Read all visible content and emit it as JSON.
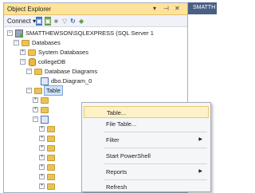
{
  "panel": {
    "title": "Object Explorer",
    "title_buttons": [
      "▾",
      "⊣",
      "✕"
    ]
  },
  "toolbar": {
    "connect_label": "Connect ▾",
    "icons": [
      "connect-object-icon",
      "disconnect-icon",
      "stop-icon",
      "filter-icon",
      "refresh-icon",
      "activity-monitor-icon"
    ]
  },
  "tree": {
    "server": "SMATTHEWSON\\SQLEXPRESS (SQL Server 1",
    "databases": "Databases",
    "system_databases": "System Databases",
    "college_db": "collegeDB",
    "database_diagrams": "Database Diagrams",
    "diagram_0": "dbo.Diagram_0",
    "tables": "Table"
  },
  "context_menu": {
    "items": [
      {
        "label": "Table...",
        "submenu": false,
        "highlighted": true
      },
      {
        "label": "File Table...",
        "submenu": false
      },
      {
        "label": "Filter",
        "submenu": true
      },
      {
        "label": "Start PowerShell",
        "submenu": false
      },
      {
        "label": "Reports",
        "submenu": true
      },
      {
        "label": "Refresh",
        "submenu": false
      }
    ]
  },
  "tab": {
    "label": "SMATTH"
  },
  "colors": {
    "title_bar": "#ffe39a",
    "menu_highlight": "#fdf2c5",
    "tab_strip": "#4a5f84"
  }
}
